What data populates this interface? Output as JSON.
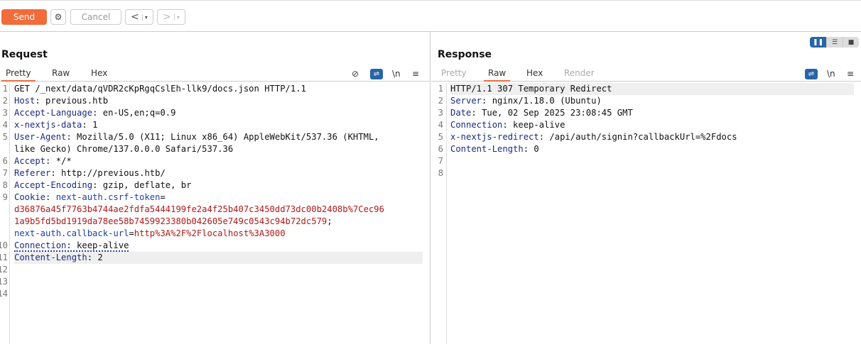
{
  "toolbar": {
    "send": "Send",
    "cancel": "Cancel",
    "back": "<",
    "forward": ">",
    "dropdown": "▾"
  },
  "request": {
    "title": "Request",
    "tabs": [
      "Pretty",
      "Raw",
      "Hex"
    ],
    "active_tab": "Pretty",
    "wrap": "⇌",
    "newline": "\\n",
    "menu": "≡",
    "hide": "⊘",
    "lines": [
      {
        "n": "1",
        "parts": [
          [
            "v",
            "GET /_next/data/qVDR2cKpRgqCslEh-llk9/docs.json HTTP/1.1"
          ]
        ]
      },
      {
        "n": "2",
        "parts": [
          [
            "k",
            "Host"
          ],
          [
            "v",
            ": previous.htb"
          ]
        ]
      },
      {
        "n": "3",
        "parts": [
          [
            "k",
            "Accept-Language"
          ],
          [
            "v",
            ": en-US,en;q=0.9"
          ]
        ]
      },
      {
        "n": "4",
        "parts": [
          [
            "k",
            "x-nextjs-data"
          ],
          [
            "v",
            ": 1"
          ]
        ]
      },
      {
        "n": "5",
        "parts": [
          [
            "k",
            "User-Agent"
          ],
          [
            "v",
            ": Mozilla/5.0 (X11; Linux x86_64) AppleWebKit/537.36 (KHTML,"
          ]
        ]
      },
      {
        "n": "",
        "parts": [
          [
            "v",
            "like Gecko) Chrome/137.0.0.0 Safari/537.36"
          ]
        ]
      },
      {
        "n": "6",
        "parts": [
          [
            "k",
            "Accept"
          ],
          [
            "v",
            ": */*"
          ]
        ]
      },
      {
        "n": "7",
        "parts": [
          [
            "k",
            "Referer"
          ],
          [
            "v",
            ": http://previous.htb/"
          ]
        ]
      },
      {
        "n": "8",
        "parts": [
          [
            "k",
            "Accept-Encoding"
          ],
          [
            "v",
            ": gzip, deflate, br"
          ]
        ]
      },
      {
        "n": "9",
        "parts": [
          [
            "k",
            "Cookie"
          ],
          [
            "v",
            ": "
          ],
          [
            "cn",
            "next-auth.csrf-token"
          ],
          [
            "v",
            "="
          ]
        ]
      },
      {
        "n": "",
        "parts": [
          [
            "cv",
            "d36876a45f7763b4744ae2fdfa5444199fe2a4f25b407c3450dd73dc00b2408b%7Cec96"
          ]
        ]
      },
      {
        "n": "",
        "parts": [
          [
            "cv",
            "1a9b5fd5bd1919da78ee58b7459923380b042605e749c0543c94b72dc579"
          ],
          [
            "v",
            ";"
          ]
        ]
      },
      {
        "n": "",
        "parts": [
          [
            "cn",
            "next-auth.callback-url"
          ],
          [
            "v",
            "="
          ],
          [
            "cv",
            "http%3A%2F%2Flocalhost%3A3000"
          ]
        ]
      },
      {
        "n": "10",
        "dotted": true,
        "parts": [
          [
            "k",
            "Connection"
          ],
          [
            "v",
            ": keep-alive"
          ]
        ]
      },
      {
        "n": "11",
        "hl": true,
        "parts": [
          [
            "k",
            "Content-Length"
          ],
          [
            "v",
            ": 2"
          ]
        ]
      },
      {
        "n": "12",
        "parts": []
      },
      {
        "n": "13",
        "parts": []
      },
      {
        "n": "14",
        "parts": []
      }
    ]
  },
  "response": {
    "title": "Response",
    "tabs": [
      "Pretty",
      "Raw",
      "Hex",
      "Render"
    ],
    "active_tab": "Raw",
    "wrap": "⇌",
    "newline": "\\n",
    "menu": "≡",
    "lines": [
      {
        "n": "1",
        "hl": true,
        "parts": [
          [
            "v",
            "HTTP/1.1 307 Temporary Redirect"
          ]
        ]
      },
      {
        "n": "2",
        "parts": [
          [
            "k",
            "Server"
          ],
          [
            "v",
            ": nginx/1.18.0 (Ubuntu)"
          ]
        ]
      },
      {
        "n": "3",
        "parts": [
          [
            "k",
            "Date"
          ],
          [
            "v",
            ": Tue, 02 Sep 2025 23:08:45 GMT"
          ]
        ]
      },
      {
        "n": "4",
        "parts": [
          [
            "k",
            "Connection"
          ],
          [
            "v",
            ": keep-alive"
          ]
        ]
      },
      {
        "n": "5",
        "parts": [
          [
            "k",
            "x-nextjs-redirect"
          ],
          [
            "v",
            ": /api/auth/signin?callbackUrl=%2Fdocs"
          ]
        ]
      },
      {
        "n": "6",
        "parts": [
          [
            "k",
            "Content-Length"
          ],
          [
            "v",
            ": 0"
          ]
        ]
      },
      {
        "n": "7",
        "parts": []
      },
      {
        "n": "8",
        "parts": []
      }
    ]
  }
}
